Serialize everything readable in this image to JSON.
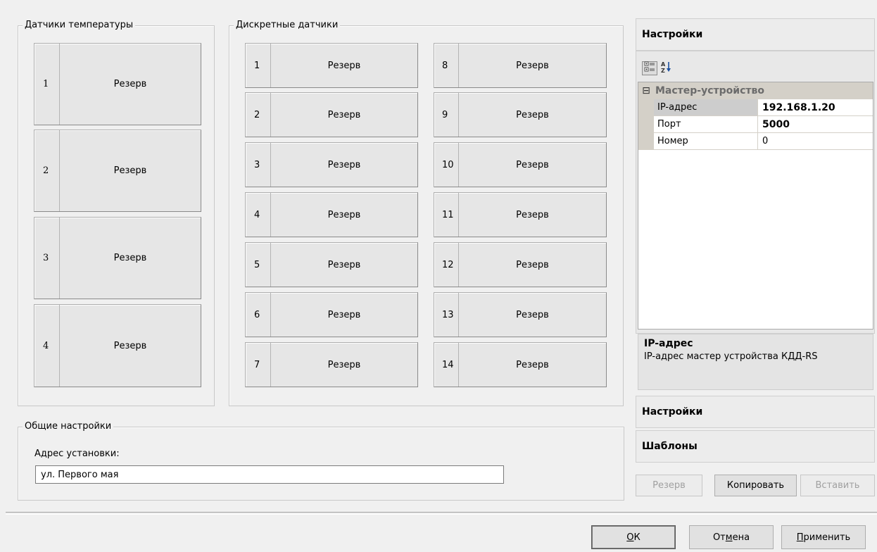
{
  "temp_group": {
    "title": "Датчики температуры",
    "sensors": [
      {
        "num": "1",
        "label": "Резерв"
      },
      {
        "num": "2",
        "label": "Резерв"
      },
      {
        "num": "3",
        "label": "Резерв"
      },
      {
        "num": "4",
        "label": "Резерв"
      }
    ]
  },
  "discrete_group": {
    "title": "Дискретные датчики",
    "left": [
      {
        "num": "1",
        "label": "Резерв"
      },
      {
        "num": "2",
        "label": "Резерв"
      },
      {
        "num": "3",
        "label": "Резерв"
      },
      {
        "num": "4",
        "label": "Резерв"
      },
      {
        "num": "5",
        "label": "Резерв"
      },
      {
        "num": "6",
        "label": "Резерв"
      },
      {
        "num": "7",
        "label": "Резерв"
      }
    ],
    "right": [
      {
        "num": "8",
        "label": "Резерв"
      },
      {
        "num": "9",
        "label": "Резерв"
      },
      {
        "num": "10",
        "label": "Резерв"
      },
      {
        "num": "11",
        "label": "Резерв"
      },
      {
        "num": "12",
        "label": "Резерв"
      },
      {
        "num": "13",
        "label": "Резерв"
      },
      {
        "num": "14",
        "label": "Резерв"
      }
    ]
  },
  "general": {
    "title": "Общие настройки",
    "address_label": "Адрес установки:",
    "address_value": "ул. Первого мая"
  },
  "right_panel": {
    "header": "Настройки",
    "toolbar": {
      "categorized_icon": "categorized-icon",
      "alphabetical_icon": "sort-az-icon"
    },
    "category": {
      "toggle": "⊟",
      "name": "Мастер-устройство"
    },
    "properties": [
      {
        "name": "IP-адрес",
        "value": "192.168.1.20"
      },
      {
        "name": "Порт",
        "value": "5000"
      },
      {
        "name": "Номер",
        "value": "0"
      }
    ],
    "description": {
      "title": "IP-адрес",
      "text": "IP-адрес мастер устройства КДД-RS"
    },
    "section_settings": "Настройки",
    "section_templates": "Шаблоны",
    "buttons": {
      "reserve": "Резерв",
      "copy": "Копировать",
      "paste": "Вставить"
    }
  },
  "dialog_buttons": {
    "ok": {
      "before": "",
      "mnemonic": "О",
      "after": "К"
    },
    "cancel": {
      "before": "От",
      "mnemonic": "м",
      "after": "ена"
    },
    "apply": {
      "before": "",
      "mnemonic": "П",
      "after": "рименить"
    }
  }
}
